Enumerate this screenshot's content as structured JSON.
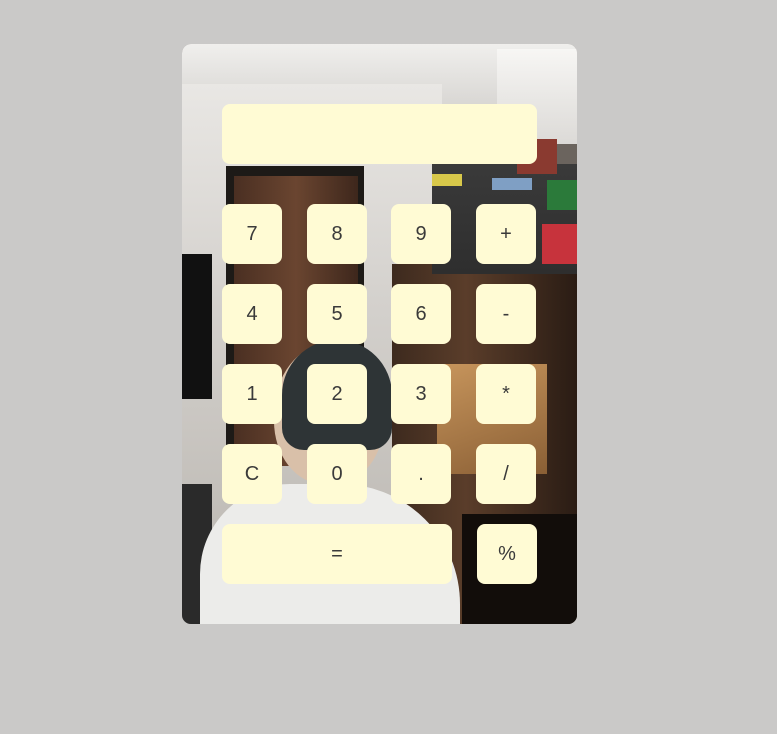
{
  "display": {
    "value": ""
  },
  "keys": {
    "seven": "7",
    "eight": "8",
    "nine": "9",
    "plus": "+",
    "four": "4",
    "five": "5",
    "six": "6",
    "minus": "-",
    "one": "1",
    "two": "2",
    "three": "3",
    "multiply": "*",
    "clear": "C",
    "zero": "0",
    "decimal": ".",
    "divide": "/",
    "equals": "=",
    "percent": "%"
  },
  "colors": {
    "page_background": "#cac9c8",
    "key_background": "#fffbd4",
    "key_text": "#3a3a3a"
  }
}
